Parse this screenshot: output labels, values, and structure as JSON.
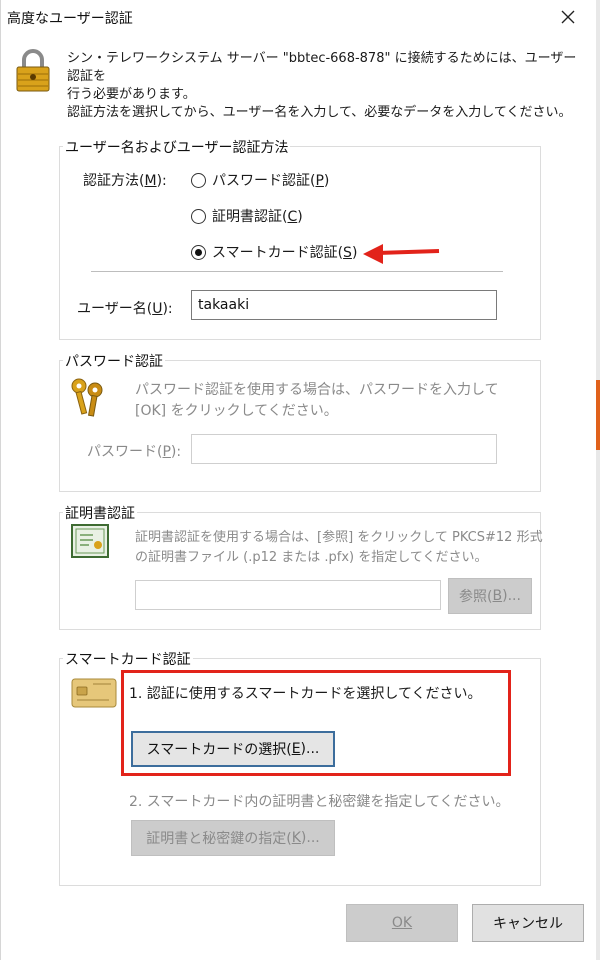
{
  "window": {
    "title": "高度なユーザー認証",
    "header_line1": "シン・テレワークシステム サーバー \"bbtec-668-878\" に接続するためには、ユーザー認証を",
    "header_line2": "行う必要があります。",
    "header_line3": "認証方法を選択してから、ユーザー名を入力して、必要なデータを入力してください。"
  },
  "user_group": {
    "title": "ユーザー名およびユーザー認証方法",
    "auth_method_label": "認証方法(M):",
    "options": [
      {
        "label": "パスワード認証(P)",
        "checked": false
      },
      {
        "label": "証明書認証(C)",
        "checked": false
      },
      {
        "label": "スマートカード認証(S)",
        "checked": true
      }
    ],
    "username_label": "ユーザー名(U):",
    "username_value": "takaaki"
  },
  "password_group": {
    "title": "パスワード認証",
    "desc1": "パスワード認証を使用する場合は、パスワードを入力して",
    "desc2": "[OK] をクリックしてください。",
    "password_label": "パスワード(P):",
    "password_value": ""
  },
  "cert_group": {
    "title": "証明書認証",
    "desc1": "証明書認証を使用する場合は、[参照] をクリックして PKCS#12 形式",
    "desc2": "の証明書ファイル (.p12 または .pfx) を指定してください。",
    "file_value": "",
    "browse_label": "参照(B)..."
  },
  "smartcard_group": {
    "title": "スマートカード認証",
    "step1": "1. 認証に使用するスマートカードを選択してください。",
    "select_label": "スマートカードの選択(E)...",
    "step2": "2. スマートカード内の証明書と秘密鍵を指定してください。",
    "specify_label": "証明書と秘密鍵の指定(K)..."
  },
  "footer": {
    "ok_label": "OK",
    "cancel_label": "キャンセル"
  },
  "colors": {
    "annotation_red": "#e2231a",
    "lock_gold": "#d9a21b"
  }
}
